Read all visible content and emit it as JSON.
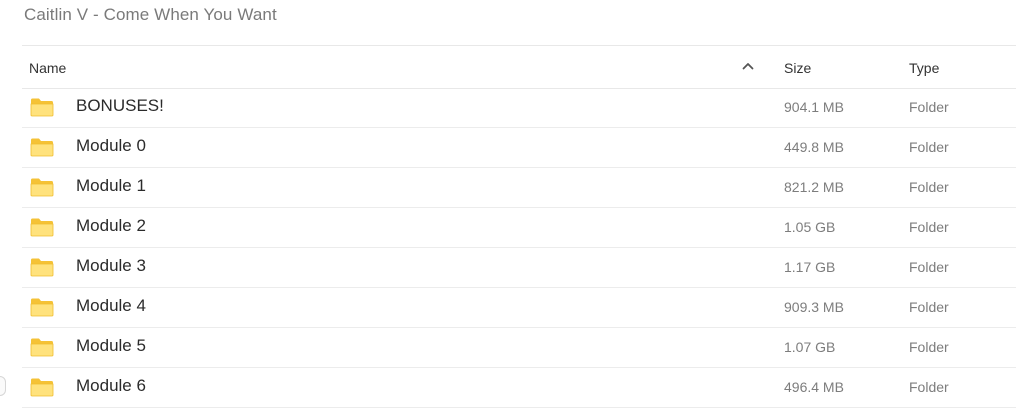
{
  "breadcrumb": {
    "title": "Caitlin V - Come When You Want"
  },
  "columns": {
    "name": "Name",
    "size": "Size",
    "type": "Type",
    "sort_icon": "chevron-up-icon"
  },
  "colors": {
    "folder_fill": "#ffd24d",
    "folder_tab": "#f5c236",
    "folder_front": "#ffe27d",
    "divider": "#e8e8e8"
  },
  "rows": [
    {
      "name": "BONUSES!",
      "size": "904.1 MB",
      "type": "Folder",
      "icon": "folder-icon"
    },
    {
      "name": "Module 0",
      "size": "449.8 MB",
      "type": "Folder",
      "icon": "folder-icon"
    },
    {
      "name": "Module 1",
      "size": "821.2 MB",
      "type": "Folder",
      "icon": "folder-icon"
    },
    {
      "name": "Module 2",
      "size": "1.05 GB",
      "type": "Folder",
      "icon": "folder-icon"
    },
    {
      "name": "Module 3",
      "size": "1.17 GB",
      "type": "Folder",
      "icon": "folder-icon"
    },
    {
      "name": "Module 4",
      "size": "909.3 MB",
      "type": "Folder",
      "icon": "folder-icon"
    },
    {
      "name": "Module 5",
      "size": "1.07 GB",
      "type": "Folder",
      "icon": "folder-icon"
    },
    {
      "name": "Module 6",
      "size": "496.4 MB",
      "type": "Folder",
      "icon": "folder-icon"
    }
  ]
}
